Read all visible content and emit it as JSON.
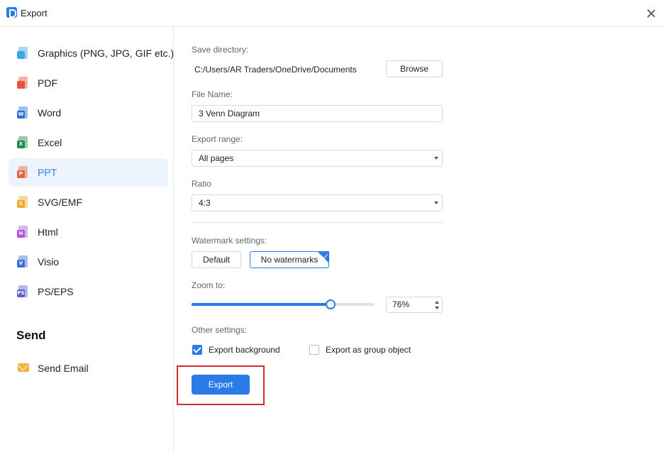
{
  "window": {
    "title": "Export"
  },
  "sidebar": {
    "items": [
      {
        "label": "Graphics (PNG, JPG, GIF etc.)",
        "icon": "image-file-icon",
        "color": "#39a8e6",
        "badge": ""
      },
      {
        "label": "PDF",
        "icon": "pdf-file-icon",
        "color": "#e8533e",
        "badge": ""
      },
      {
        "label": "Word",
        "icon": "word-file-icon",
        "color": "#2d6fd6",
        "badge": "W"
      },
      {
        "label": "Excel",
        "icon": "excel-file-icon",
        "color": "#1f8a4c",
        "badge": "X"
      },
      {
        "label": "PPT",
        "icon": "ppt-file-icon",
        "color": "#e8643e",
        "badge": "P",
        "active": true
      },
      {
        "label": "SVG/EMF",
        "icon": "svg-file-icon",
        "color": "#f0a82c",
        "badge": "S"
      },
      {
        "label": "Html",
        "icon": "html-file-icon",
        "color": "#b254e0",
        "badge": "H"
      },
      {
        "label": "Visio",
        "icon": "visio-file-icon",
        "color": "#3b6fd6",
        "badge": "V"
      },
      {
        "label": "PS/EPS",
        "icon": "ps-file-icon",
        "color": "#5a62c9",
        "badge": "PS"
      }
    ],
    "send_heading": "Send",
    "send_email": "Send Email"
  },
  "form": {
    "save_directory_label": "Save directory:",
    "save_directory_value": "C:/Users/AR Traders/OneDrive/Documents",
    "browse_label": "Browse",
    "file_name_label": "File Name:",
    "file_name_value": "3 Venn Diagram",
    "export_range_label": "Export range:",
    "export_range_value": "All pages",
    "ratio_label": "Ratio",
    "ratio_value": "4:3",
    "watermark_label": "Watermark settings:",
    "watermark_default": "Default",
    "watermark_none": "No watermarks",
    "zoom_label": "Zoom to:",
    "zoom_value": "76%",
    "zoom_fraction": 0.76,
    "other_label": "Other settings:",
    "export_background_label": "Export background",
    "export_background_checked": true,
    "export_group_label": "Export as group object",
    "export_group_checked": false,
    "export_button": "Export"
  },
  "colors": {
    "accent": "#2a7ae8",
    "active_bg": "#eef4fd",
    "highlight": "#d42a2a"
  }
}
